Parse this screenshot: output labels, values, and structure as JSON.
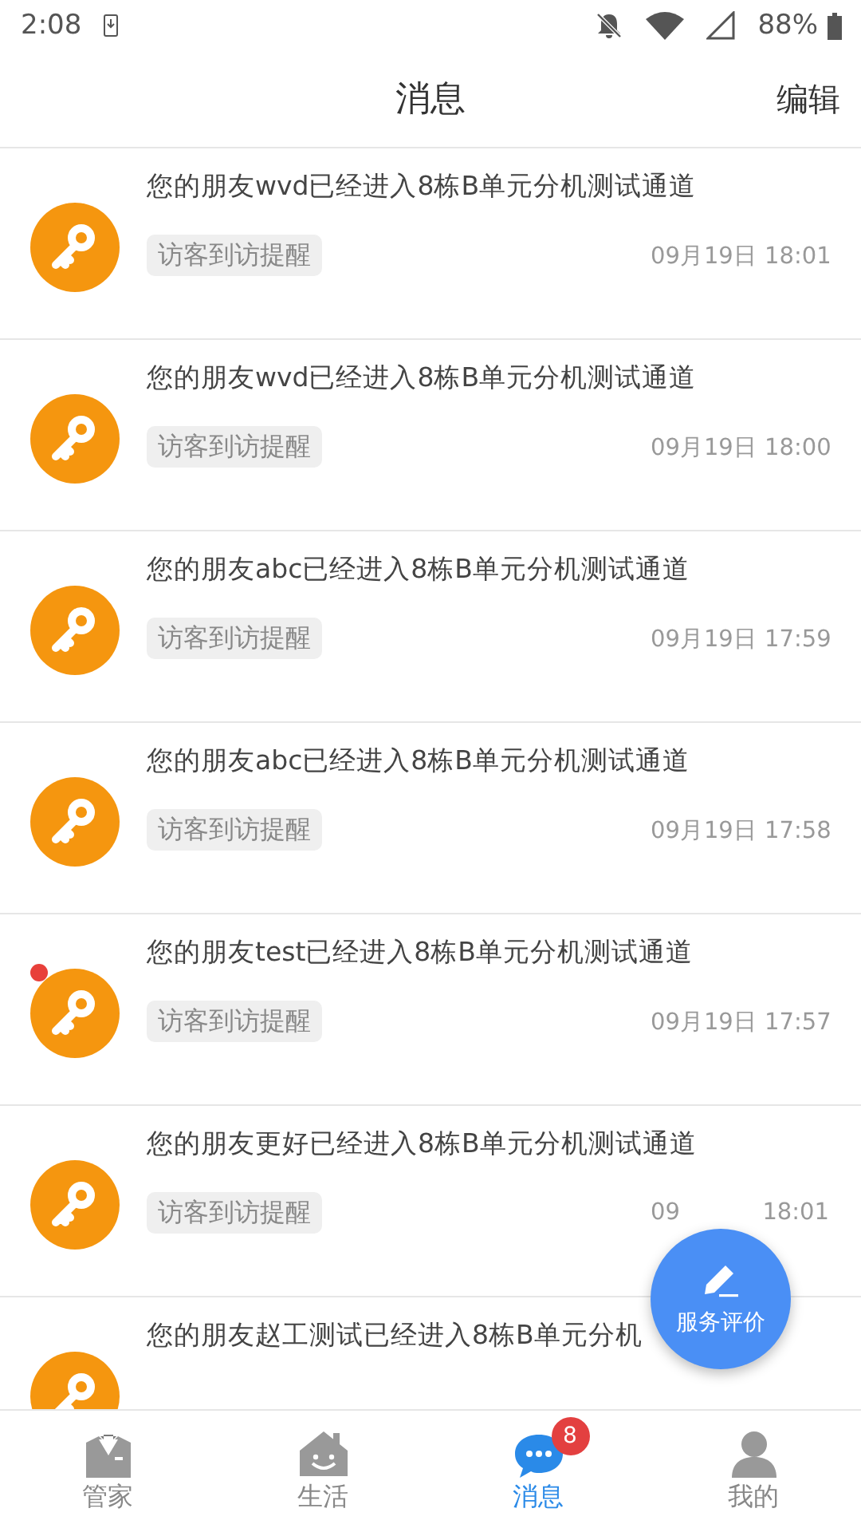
{
  "status_bar": {
    "time": "2:08",
    "battery": "88%"
  },
  "header": {
    "title": "消息",
    "action": "编辑"
  },
  "messages": [
    {
      "text": "您的朋友wvd已经进入8栋B单元分机测试通道",
      "tag": "访客到访提醒",
      "time": "09月19日 18:01",
      "unread": false
    },
    {
      "text": "您的朋友wvd已经进入8栋B单元分机测试通道",
      "tag": "访客到访提醒",
      "time": "09月19日 18:00",
      "unread": false
    },
    {
      "text": "您的朋友abc已经进入8栋B单元分机测试通道",
      "tag": "访客到访提醒",
      "time": "09月19日 17:59",
      "unread": false
    },
    {
      "text": "您的朋友abc已经进入8栋B单元分机测试通道",
      "tag": "访客到访提醒",
      "time": "09月19日 17:58",
      "unread": false
    },
    {
      "text": "您的朋友test已经进入8栋B单元分机测试通道",
      "tag": "访客到访提醒",
      "time": "09月19日 17:57",
      "unread": true
    },
    {
      "text": "您的朋友更好已经进入8栋B单元分机测试通道",
      "tag": "访客到访提醒",
      "time_lead": "09",
      "time": "18:01",
      "unread": false
    },
    {
      "text": "您的朋友赵工测试已经进入8栋B单元分机",
      "unread": false
    }
  ],
  "fab": {
    "label": "服务评价"
  },
  "tabs": [
    {
      "label": "管家",
      "selected": false
    },
    {
      "label": "生活",
      "selected": false
    },
    {
      "label": "消息",
      "selected": true,
      "badge": "8"
    },
    {
      "label": "我的",
      "selected": false
    }
  ]
}
